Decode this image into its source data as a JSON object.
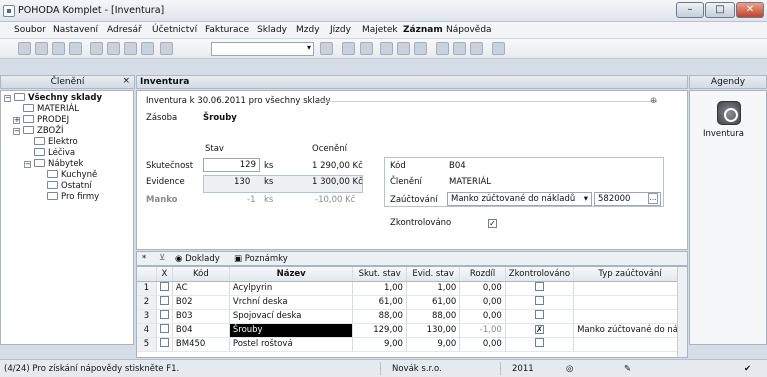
{
  "window": {
    "title": "POHODA Komplet - [Inventura]"
  },
  "menu": [
    "Soubor",
    "Nastavení",
    "Adresář",
    "Účetnictví",
    "Fakturace",
    "Sklady",
    "Mzdy",
    "Jízdy",
    "Majetek",
    "Záznam",
    "Nápověda"
  ],
  "left": {
    "title": "Členění",
    "close": "×",
    "tree": [
      "Všechny sklady",
      "MATERIÁL",
      "PRODEJ",
      "ZBOŽÍ",
      "Elektro",
      "Léčiva",
      "Nábytek",
      "Kuchyně",
      "Ostatní",
      "Pro firmy"
    ]
  },
  "main": {
    "title": "Inventura"
  },
  "agenda": {
    "title": "Agendy",
    "item": "Inventura"
  },
  "form": {
    "header": "Inventura k 30.06.2011 pro všechny sklady",
    "zasoba_label": "Zásoba",
    "zasoba_value": "Šrouby",
    "col_stav": "Stav",
    "col_oceneni": "Ocenění",
    "skutecnost_label": "Skutečnost",
    "skutecnost_value": "129",
    "skutecnost_unit": "ks",
    "skutecnost_price": "1 290,00 Kč",
    "evidence_label": "Evidence",
    "evidence_value": "130",
    "evidence_unit": "ks",
    "evidence_price": "1 300,00 Kč",
    "manko_label": "Manko",
    "manko_value": "-1",
    "manko_unit": "ks",
    "manko_price": "-10,00 Kč",
    "kod_label": "Kód",
    "kod_value": "B04",
    "cleneni_label": "Členění",
    "cleneni_value": "MATERIÁL",
    "zauctovani_label": "Zaúčtování",
    "zauctovani_value": "Manko zúčtované do nákladů",
    "ucet_value": "582000",
    "zkontrolovano_label": "Zkontrolováno"
  },
  "tabs": {
    "star": "*",
    "doklady": "Doklady",
    "poznamky": "Poznámky"
  },
  "grid": {
    "columns": [
      "X",
      "Kód",
      "Název",
      "Skut. stav",
      "Evid. stav",
      "Rozdíl",
      "Zkontrolováno",
      "Typ zaúčtování"
    ],
    "rows": [
      {
        "n": "1",
        "kod": "AC",
        "nazev": "Acylpyrin",
        "skut": "1,00",
        "evid": "1,00",
        "rozdil": "0,00",
        "typ": ""
      },
      {
        "n": "2",
        "kod": "B02",
        "nazev": "Vrchní deska",
        "skut": "61,00",
        "evid": "61,00",
        "rozdil": "0,00",
        "typ": ""
      },
      {
        "n": "3",
        "kod": "B03",
        "nazev": "Spojovací deska",
        "skut": "88,00",
        "evid": "88,00",
        "rozdil": "0,00",
        "typ": ""
      },
      {
        "n": "4",
        "kod": "B04",
        "nazev": "Šrouby",
        "skut": "129,00",
        "evid": "130,00",
        "rozdil": "-1,00",
        "typ": "Manko zúčtované do nák"
      },
      {
        "n": "5",
        "kod": "BM450",
        "nazev": "Postel roštová",
        "skut": "9,00",
        "evid": "9,00",
        "rozdil": "0,00",
        "typ": ""
      }
    ]
  },
  "status": {
    "help": "(4/24) Pro získání nápovědy stiskněte F1.",
    "company": "Novák s.r.o.",
    "year": "2011"
  }
}
